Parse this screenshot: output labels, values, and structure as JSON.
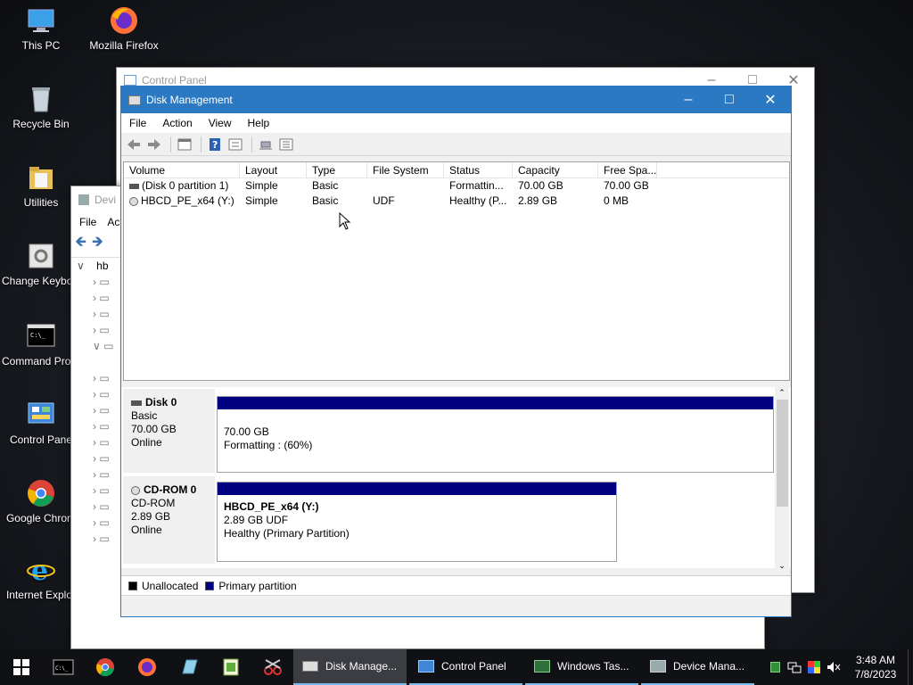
{
  "desktop": {
    "icons": [
      {
        "label": "This PC"
      },
      {
        "label": "Mozilla Firefox"
      },
      {
        "label": "Recycle Bin"
      },
      {
        "label": "Utilities"
      },
      {
        "label": "Change Keyboard Layo"
      },
      {
        "label": "Command Prompt"
      },
      {
        "label": "Control Pane"
      },
      {
        "label": "Google Chrom"
      },
      {
        "label": "Internet Explor"
      }
    ]
  },
  "control_panel_window": {
    "title": "Control Panel"
  },
  "device_manager_window": {
    "title": "Devi",
    "menu_file": "File",
    "menu_action": "Ac",
    "tree_root": "hb"
  },
  "disk_management": {
    "title": "Disk Management",
    "menu": [
      "File",
      "Action",
      "View",
      "Help"
    ],
    "columns": [
      "Volume",
      "Layout",
      "Type",
      "File System",
      "Status",
      "Capacity",
      "Free Spa..."
    ],
    "volumes": [
      {
        "volume": "(Disk 0 partition 1)",
        "layout": "Simple",
        "type": "Basic",
        "fs": "",
        "status": "Formattin...",
        "capacity": "70.00 GB",
        "free": "70.00 GB"
      },
      {
        "volume": "HBCD_PE_x64 (Y:)",
        "layout": "Simple",
        "type": "Basic",
        "fs": "UDF",
        "status": "Healthy (P...",
        "capacity": "2.89 GB",
        "free": "0 MB"
      }
    ],
    "disks": [
      {
        "name": "Disk 0",
        "kind": "Basic",
        "size": "70.00 GB",
        "state": "Online",
        "partition": {
          "label": "",
          "line1": "70.00 GB",
          "line2": "Formatting : (60%)"
        }
      },
      {
        "name": "CD-ROM 0",
        "kind": "CD-ROM",
        "size": "2.89 GB",
        "state": "Online",
        "partition": {
          "label": "HBCD_PE_x64  (Y:)",
          "line1": "2.89 GB UDF",
          "line2": "Healthy (Primary Partition)"
        }
      }
    ],
    "legend": [
      {
        "label": "Unallocated",
        "color": "#000000"
      },
      {
        "label": "Primary partition",
        "color": "#000080"
      }
    ]
  },
  "taskbar": {
    "tasks": [
      {
        "label": "Disk Manage...",
        "active": true
      },
      {
        "label": "Control Panel",
        "active": false
      },
      {
        "label": "Windows Tas...",
        "active": false
      },
      {
        "label": "Device Mana...",
        "active": false
      }
    ],
    "time": "3:48 AM",
    "date": "7/8/2023"
  },
  "colors": {
    "titlebar": "#2b79c2",
    "primary_partition": "#000080",
    "taskbar": "#101114"
  }
}
